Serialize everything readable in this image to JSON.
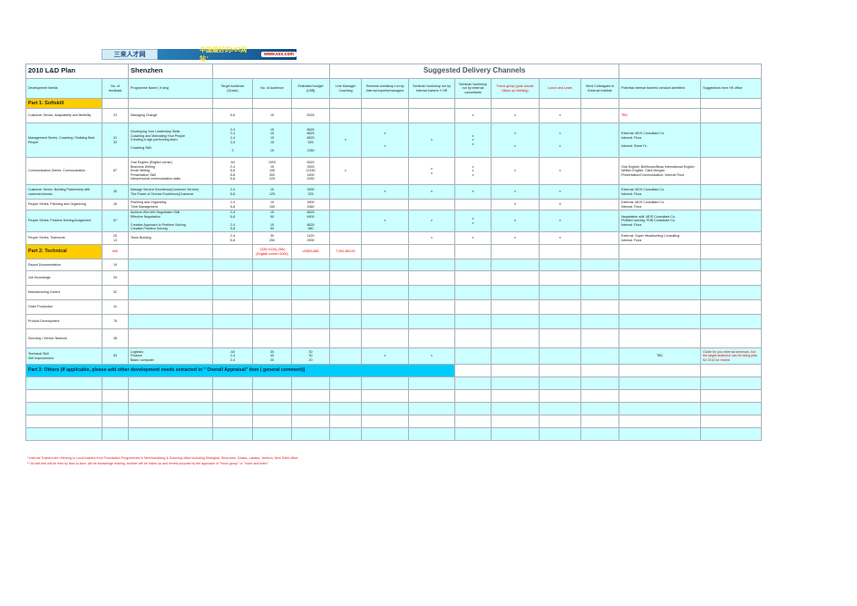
{
  "banner": {
    "left": "三来人才网",
    "title": "中国最好的HR网站：",
    "url": "www.xxx.com"
  },
  "plan_title": "2010 L&D Plan",
  "location": "Shenzhen",
  "suggested_header": "Suggested Delivery Channels",
  "columns": [
    "Development Needs",
    "No. of feedback",
    "Programme Name ( if any)",
    "Target Audience (Grade)",
    "No. of Audience",
    "Estimated budget (US$)",
    "Line Manager Coaching",
    "Seminar/ workshop run by internal experts/managers",
    "Seminar/ workshop run by internal trainers */ HR",
    "Seminar/ workshop run by external consultants",
    "Focus group (post-course follow up meeting)",
    "Lunch and Learn",
    "Send Colleagues to External Institute",
    "Potential internal trainers/ vendors identified",
    "Suggestions from HK office"
  ],
  "part1": {
    "label": "Part 1: Softskill",
    "rows": [
      {
        "need": "Customer Sevice, Adaptability and flexibility",
        "fb": "23",
        "prog": "Managing Change",
        "grade": "5-8",
        "aud": "15",
        "budget": "6325",
        "lm": "",
        "int": "",
        "hr": "",
        "ext": "x",
        "fg": "x",
        "ll": "x",
        "sc": "",
        "vendor": "TBC",
        "hk": ""
      },
      {
        "need": "Management Series, Coaching / Building Best People",
        "fb": "21\n32",
        "prog": "Developing Your Leadership Skills\nCoaching and Motivating Your People\nCreating a high performing team\n\nCoaching Skill",
        "grade": "2-4\n2-4\n2-4\n3-5\n\n3",
        "aud": "15\n15\n15\n15\n\n15",
        "budget": "8625\n8625\n8625\n525\n\n1380",
        "lm": "x",
        "int": "x\n\n\nx",
        "hr": "x",
        "ext": "x\nx\nx\n",
        "fg": "x\n\n\nx",
        "ll": "x\n\n\nx",
        "sc": "",
        "vendor": "External: MDS Consultant Co.\nInternal: Flora\n\nInternal: Steve Fu",
        "hk": ""
      },
      {
        "need": "Communication Series: Communication",
        "fb": "67",
        "prog": "Oral English (English corner)\nBusiness Writing\nEmail Writing\nPresentation Skill\nInterpersonal communication skills",
        "grade": "All\n2-4\n5-8\n5-8\n5-8",
        "aud": "1000\n15\n150\n300\n225",
        "budget": "6520\n3925\n12150\n1500\n2250",
        "lm": "x",
        "int": "",
        "hr": "x\nx",
        "ext": "x\nx\nx",
        "fg": "x",
        "ll": "x",
        "sc": "",
        "vendor": "Oral English: Beeflonce/Beau International English\nWritten English: Clark Morgan\nPresentation/Communication: Internal Flora",
        "hk": ""
      },
      {
        "need": "Customer Series: Building Partnership with customer/vendor",
        "fb": "30",
        "prog": "Manage Service Excellence(Customer Service)\nThe Power of Service Excellence(Customer",
        "grade": "2-4\n5-8",
        "aud": "15\n125",
        "budget": "3900\n325",
        "lm": "",
        "int": "x",
        "hr": "x",
        "ext": "x",
        "fg": "x",
        "ll": "x",
        "sc": "",
        "vendor": "External: MDS Consultant Co.\nInternal: Flora",
        "hk": ""
      },
      {
        "need": "People Series: Planning and Organizing",
        "fb": "26",
        "prog": "Planning and Organizing\nTime Management",
        "grade": "2-4\n5-8",
        "aud": "15\n150",
        "budget": "3900\n1560",
        "lm": "",
        "int": "",
        "hr": "",
        "ext": "",
        "fg": "X",
        "ll": "X",
        "sc": "",
        "vendor": "External: MDS Consultant Co.\nInternal: Flora",
        "hk": ""
      },
      {
        "need": "People Series: Problem Solving/Judgement",
        "fb": "67",
        "prog": "Achieve Win-Win Negotiation Skill\nEffective Negotiation\n\nCreative Approach to Problem Solving\nCreative Problem Solving",
        "grade": "2-4\n5-8\n\n2-4\n5-8",
        "aud": "15\n50\n\n15\n50",
        "budget": "8625\n6900\n\n8625\n980",
        "lm": "",
        "int": "x",
        "hr": "x",
        "ext": "x\nx\n",
        "fg": "x",
        "ll": "x",
        "sc": "",
        "vendor": "Negotiation skill: MDS Consultant Co.\nProblem solving: PHB Consultant Co.\nInternal: Flora",
        "hk": ""
      },
      {
        "need": "People Series: Teamwork",
        "fb": "20\n13",
        "prog": "Team Building",
        "grade": "2-4\n5-8",
        "aud": "30\n250",
        "budget": "1420\n2900",
        "lm": "",
        "int": "",
        "hr": "x",
        "ext": "x",
        "fg": "x",
        "ll": "x",
        "sc": "",
        "vendor": "External: Super Headhunting Consulting\nInternal: Flora",
        "hk": ""
      }
    ]
  },
  "part2": {
    "label": "Part 2: Technical",
    "fb_total": "640",
    "aud_total": "1335+4120(-265)\n(English corner=1000)",
    "budget_total": "US$93,885",
    "extra_total": "7,951,850.00",
    "rows": [
      {
        "need": "Report Documentation",
        "fb": "19"
      },
      {
        "need": "Job Knowledge",
        "fb": "29"
      },
      {
        "need": "Manufacturing Control",
        "fb": "52"
      },
      {
        "need": "Order Production",
        "fb": "41"
      },
      {
        "need": "Product Development",
        "fb": "76"
      },
      {
        "need": "Sourcing / Vendor Network",
        "fb": "38"
      }
    ],
    "tech": {
      "need": "Technical Skill\nSelf Improvement",
      "fb": "63",
      "prog": "Logistics\nFinance\nBasic/ computer",
      "grade": "All\n2-4\n2-4",
      "aud": "30\n40\n20",
      "budget": "30\n30\n20",
      "int": "x",
      "hr": "x",
      "vendor": "TBC",
      "hk": "Guide for you external seminars, but the target audience can be being plan for 2010 for review"
    }
  },
  "part3": {
    "label": "Part 3: Others (If applicable, please add other development needs extracted in \" Overall Appraisal\" item ( general comment))"
  },
  "footnotes": [
    "* Internal Trainers are referring to Local trainers from Foundation Programmes in Merchandising & Sourcing office including Shanghai, Shenzhen, Dhaka, Lanaka, Ventura, New Delhi office",
    "** All self-test will be held by face-to-face, will be knowledge sharing, another will be follow up and review purpose by the approach of \"focus group\" or \"lunch and learn\""
  ]
}
